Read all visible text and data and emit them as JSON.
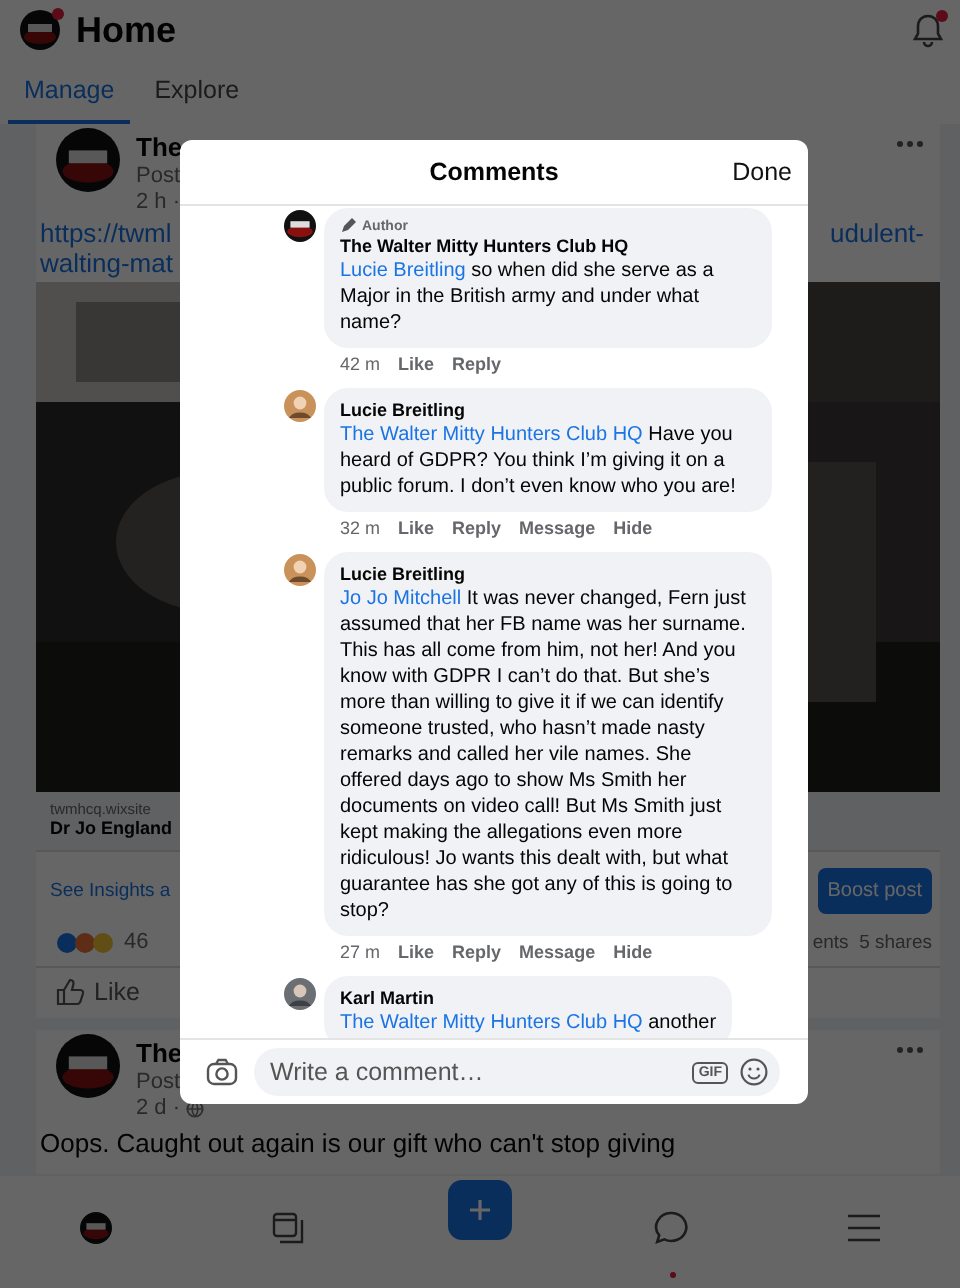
{
  "header": {
    "title": "Home",
    "avatar_notification": true,
    "bell_notification": true
  },
  "tabs": [
    {
      "label": "Manage",
      "selected": true
    },
    {
      "label": "Explore",
      "selected": false
    }
  ],
  "posts": [
    {
      "kind": "link",
      "author": "The",
      "byline": "Post",
      "time": "2 h ·",
      "link_start": "https://twml",
      "link_end": "udulent-",
      "link_line2": "walting-mat",
      "preview_domain": "twmhcq.wixsite",
      "preview_title": "Dr Jo England",
      "insights": "See Insights a",
      "boost": "Boost post",
      "reaction_count": "46",
      "stats": "ents  5 shares",
      "like": "Like"
    },
    {
      "kind": "status",
      "author": "The",
      "byline": "Post",
      "time": "2 d ·",
      "text": "Oops. Caught out again is our gift who can't stop giving"
    }
  ],
  "bottom_nav": [
    {
      "kind": "avatar",
      "notification": false
    },
    {
      "kind": "pages",
      "notification": false
    },
    {
      "kind": "create",
      "notification": false
    },
    {
      "kind": "chat",
      "notification": true
    },
    {
      "kind": "menu",
      "notification": false
    }
  ],
  "comments_dialog": {
    "title": "Comments",
    "done": "Done",
    "comments": [
      {
        "kind": "page",
        "badge": "Author",
        "author": "The Walter Mitty Hunters Club HQ",
        "mention": "Lucie Breitling",
        "text": "so when did she serve as a Major in the British army and under what name?",
        "time": "42 m",
        "actions": [
          "Like",
          "Reply"
        ]
      },
      {
        "kind": "person",
        "author": "Lucie Breitling",
        "mention": "The Walter Mitty Hunters Club HQ",
        "text": "Have you heard of GDPR? You think I’m giving it on a public forum. I don’t even know who you are!",
        "time": "32 m",
        "actions": [
          "Like",
          "Reply",
          "Message",
          "Hide"
        ]
      },
      {
        "kind": "person",
        "author": "Lucie Breitling",
        "mention": "Jo Jo Mitchell",
        "text": "It was never changed, Fern just assumed that her FB name was her surname. This has all come from him, not her! And you know with GDPR I can’t do that. But she’s more than willing to give it if we can identify someone trusted, who hasn’t made nasty remarks and called her vile names. She offered days ago to show Ms Smith her documents on video call! But Ms Smith just kept making the allegations even more ridiculous! Jo wants this dealt with, but what guarantee has she got any of this is going to stop?",
        "time": "27 m",
        "actions": [
          "Like",
          "Reply",
          "Message",
          "Hide"
        ]
      },
      {
        "kind": "person2",
        "author": "Karl Martin",
        "mention": "The Walter Mitty Hunters Club HQ",
        "text": "another"
      }
    ],
    "composer": {
      "placeholder": "Write a comment…",
      "gif": "GIF"
    }
  }
}
